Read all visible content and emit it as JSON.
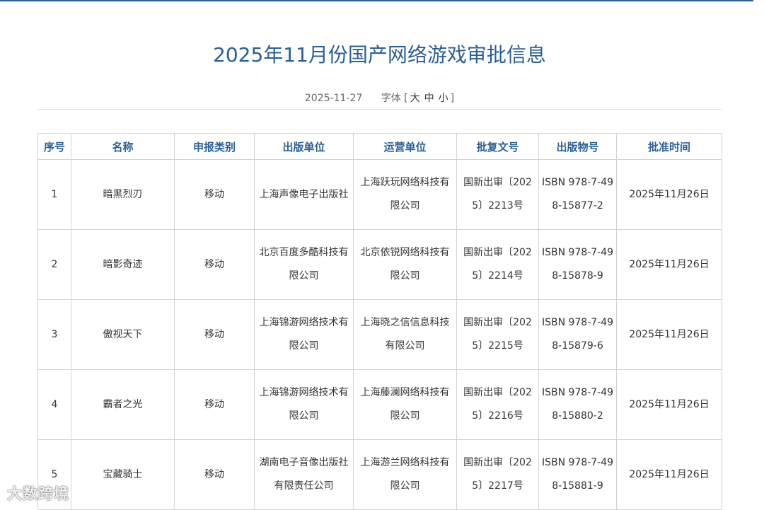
{
  "title": "2025年11月份国产网络游戏审批信息",
  "meta": {
    "date": "2025-11-27",
    "font_label": "字体",
    "bracket_open": "[",
    "size_large": "大",
    "size_medium": "中",
    "size_small": "小",
    "bracket_close": "]"
  },
  "table": {
    "headers": [
      "序号",
      "名称",
      "申报类别",
      "出版单位",
      "运营单位",
      "批复文号",
      "出版物号",
      "批准时间"
    ],
    "rows": [
      [
        "1",
        "暗黑烈刃",
        "移动",
        "上海声像电子出版社",
        "上海跃玩网络科技有限公司",
        "国新出审〔2025〕2213号",
        "ISBN 978-7-498-15877-2",
        "2025年11月26日"
      ],
      [
        "2",
        "暗影奇迹",
        "移动",
        "北京百度多酷科技有限公司",
        "北京依锐网络科技有限公司",
        "国新出审〔2025〕2214号",
        "ISBN 978-7-498-15878-9",
        "2025年11月26日"
      ],
      [
        "3",
        "傲视天下",
        "移动",
        "上海锦游网络技术有限公司",
        "上海晓之信信息科技有限公司",
        "国新出审〔2025〕2215号",
        "ISBN 978-7-498-15879-6",
        "2025年11月26日"
      ],
      [
        "4",
        "霸者之光",
        "移动",
        "上海锦游网络技术有限公司",
        "上海藤澜网络科技有限公司",
        "国新出审〔2025〕2216号",
        "ISBN 978-7-498-15880-2",
        "2025年11月26日"
      ],
      [
        "5",
        "宝藏骑士",
        "移动",
        "湖南电子音像出版社有限责任公司",
        "上海游兰网络科技有限公司",
        "国新出审〔2025〕2217号",
        "ISBN 978-7-498-15881-9",
        "2025年11月26日"
      ]
    ]
  },
  "watermark": "大数跨境"
}
